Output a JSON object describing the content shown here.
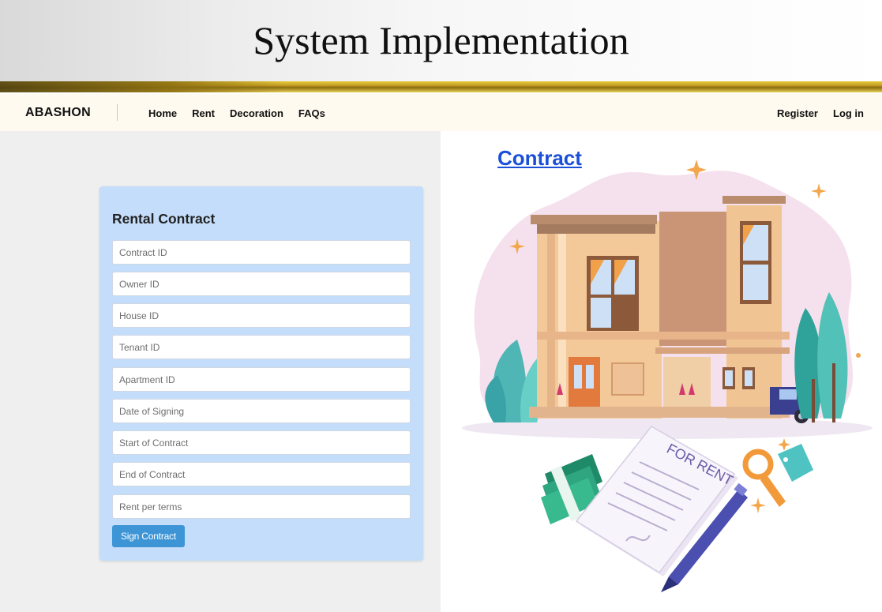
{
  "slide": {
    "title": "System Implementation"
  },
  "navbar": {
    "brand": "ABASHON",
    "left_links": [
      "Home",
      "Rent",
      "Decoration",
      "FAQs"
    ],
    "right_links": [
      "Register",
      "Log in"
    ]
  },
  "form": {
    "title": "Rental Contract",
    "fields": [
      {
        "placeholder": "Contract ID",
        "value": ""
      },
      {
        "placeholder": "Owner ID",
        "value": ""
      },
      {
        "placeholder": "House ID",
        "value": ""
      },
      {
        "placeholder": "Tenant ID",
        "value": ""
      },
      {
        "placeholder": "Apartment ID",
        "value": ""
      },
      {
        "placeholder": "Date of Signing",
        "value": ""
      },
      {
        "placeholder": "Start of Contract",
        "value": ""
      },
      {
        "placeholder": "End of Contract",
        "value": ""
      },
      {
        "placeholder": "Rent per terms",
        "value": ""
      }
    ],
    "submit_label": "Sign Contract"
  },
  "illustration": {
    "link_label": "Contract",
    "sign_text": "FOR RENT"
  },
  "colors": {
    "form_card": "#c4ddfa",
    "button": "#3d95d6",
    "link": "#1a4fd8",
    "navbar": "#fffaf0",
    "gold": "#c9a227"
  }
}
